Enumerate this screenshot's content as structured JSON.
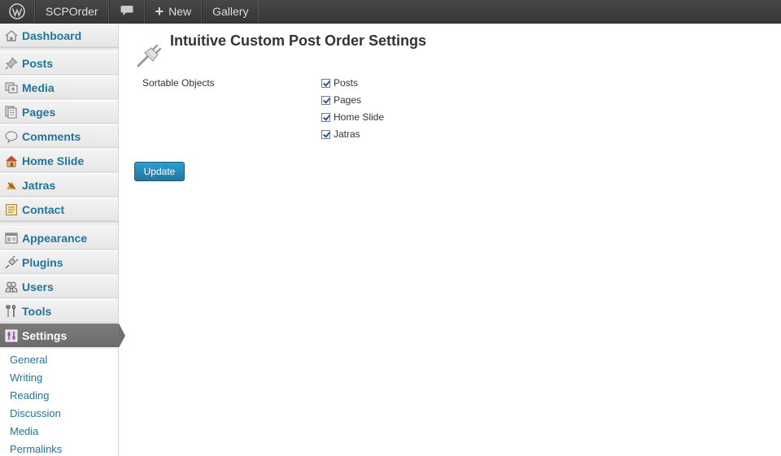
{
  "adminbar": {
    "site_name": "SCPOrder",
    "new_label": "New",
    "gallery_label": "Gallery",
    "icons": [
      "wordpress-logo-icon",
      "comment-bubble-icon",
      "plus-icon"
    ]
  },
  "sidebar": {
    "items": [
      {
        "label": "Dashboard",
        "icon": "home-icon"
      },
      {
        "label": "Posts",
        "icon": "pushpin-icon"
      },
      {
        "label": "Media",
        "icon": "media-icon"
      },
      {
        "label": "Pages",
        "icon": "pages-icon"
      },
      {
        "label": "Comments",
        "icon": "comment-icon"
      },
      {
        "label": "Home Slide",
        "icon": "house-icon"
      },
      {
        "label": "Jatras",
        "icon": "jatras-icon"
      },
      {
        "label": "Contact",
        "icon": "contact-icon"
      },
      {
        "label": "Appearance",
        "icon": "appearance-icon"
      },
      {
        "label": "Plugins",
        "icon": "plug-icon"
      },
      {
        "label": "Users",
        "icon": "users-icon"
      },
      {
        "label": "Tools",
        "icon": "tools-icon"
      },
      {
        "label": "Settings",
        "icon": "settings-icon",
        "current": true
      }
    ],
    "submenu": [
      "General",
      "Writing",
      "Reading",
      "Discussion",
      "Media",
      "Permalinks"
    ]
  },
  "main": {
    "title": "Intuitive Custom Post Order Settings",
    "sortable_label": "Sortable Objects",
    "objects": [
      {
        "label": "Posts",
        "checked": true
      },
      {
        "label": "Pages",
        "checked": true
      },
      {
        "label": "Home Slide",
        "checked": true
      },
      {
        "label": "Jatras",
        "checked": true
      }
    ],
    "update_label": "Update"
  },
  "colors": {
    "link": "#21759b",
    "adminbar_bg": "#464646",
    "current_menu_bg": "#6d6d6d",
    "button_bg": "#21759b"
  }
}
